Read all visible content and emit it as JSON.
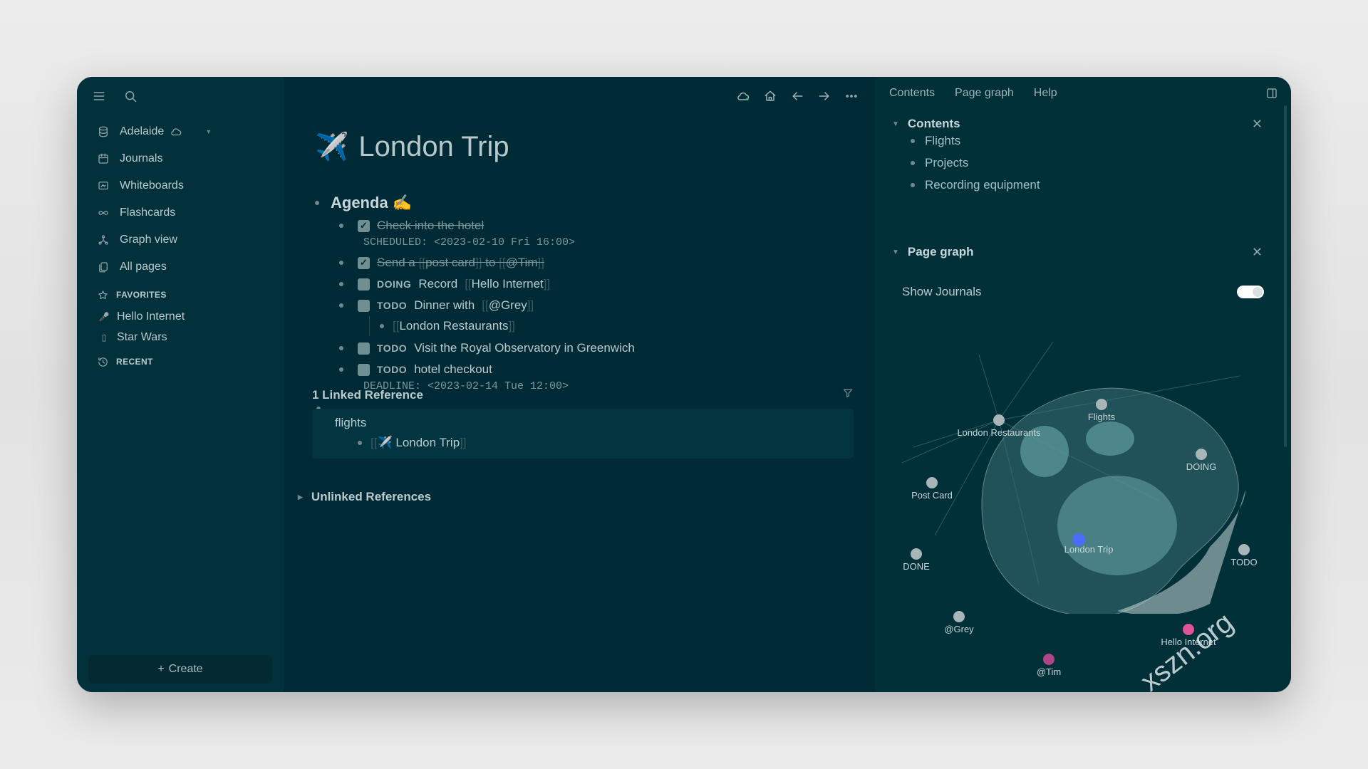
{
  "sidebar": {
    "graph_name": "Adelaide",
    "nav": [
      {
        "label": "Journals",
        "icon": "calendar-icon"
      },
      {
        "label": "Whiteboards",
        "icon": "whiteboard-icon"
      },
      {
        "label": "Flashcards",
        "icon": "infinity-icon"
      },
      {
        "label": "Graph view",
        "icon": "graph-icon"
      },
      {
        "label": "All pages",
        "icon": "pages-icon"
      }
    ],
    "favorites_label": "FAVORITES",
    "favorites": [
      {
        "label": "Hello Internet",
        "icon": "microphone-icon"
      },
      {
        "label": "Star Wars",
        "icon": "page-icon"
      }
    ],
    "recent_label": "RECENT",
    "create_label": "Create"
  },
  "main": {
    "title_emoji": "✈️",
    "title": "London Trip",
    "agenda": "Agenda",
    "agenda_emoji": "✍️",
    "tasks": [
      {
        "text": "Check into the hotel",
        "meta": "SCHEDULED: <2023-02-10 Fri 16:00>"
      },
      {
        "text_a": "Send a",
        "ref": "post card",
        "text_b": "to",
        "mention": "@Tim"
      },
      {
        "marker": "DOING",
        "text": "Record",
        "ref": "Hello Internet"
      },
      {
        "marker": "TODO",
        "text": "Dinner with",
        "ref": "@Grey",
        "child": "London Restaurants"
      },
      {
        "marker": "TODO",
        "text": "Visit the Royal Observatory in Greenwich"
      },
      {
        "marker": "TODO",
        "text": "hotel checkout",
        "meta": "DEADLINE: <2023-02-14 Tue 12:00>"
      }
    ],
    "linked_refs_title": "1 Linked Reference",
    "linked_page": "flights",
    "linked_ref_emoji": "✈️",
    "linked_ref": "London Trip",
    "unlinked_refs_title": "Unlinked References"
  },
  "right_panel": {
    "tabs": [
      "Contents",
      "Page graph",
      "Help"
    ],
    "contents_title": "Contents",
    "contents_items": [
      "Flights",
      "Projects",
      "Recording equipment"
    ],
    "graph_title": "Page graph",
    "show_journals_label": "Show Journals",
    "show_journals_on": true,
    "graph_nodes": [
      {
        "label": "London Restaurants",
        "color": "#a8b6b8"
      },
      {
        "label": "Flights",
        "color": "#a8b6b8"
      },
      {
        "label": "DOING",
        "color": "#a8b6b8"
      },
      {
        "label": "Post Card",
        "color": "#a8b6b8"
      },
      {
        "label": "London Trip",
        "color": "#4a6cff"
      },
      {
        "label": "TODO",
        "color": "#a8b6b8"
      },
      {
        "label": "DONE",
        "color": "#a8b6b8"
      },
      {
        "label": "@Grey",
        "color": "#a8b6b8"
      },
      {
        "label": "Hello Internet",
        "color": "#e0559a"
      },
      {
        "label": "@Tim",
        "color": "#b0458a"
      }
    ]
  },
  "watermark": "xszn.org",
  "colors": {
    "window_bg": "#002b36",
    "sidebar_bg": "#02313c",
    "accent_blue": "#4a6cff",
    "accent_pink": "#e0559a"
  }
}
